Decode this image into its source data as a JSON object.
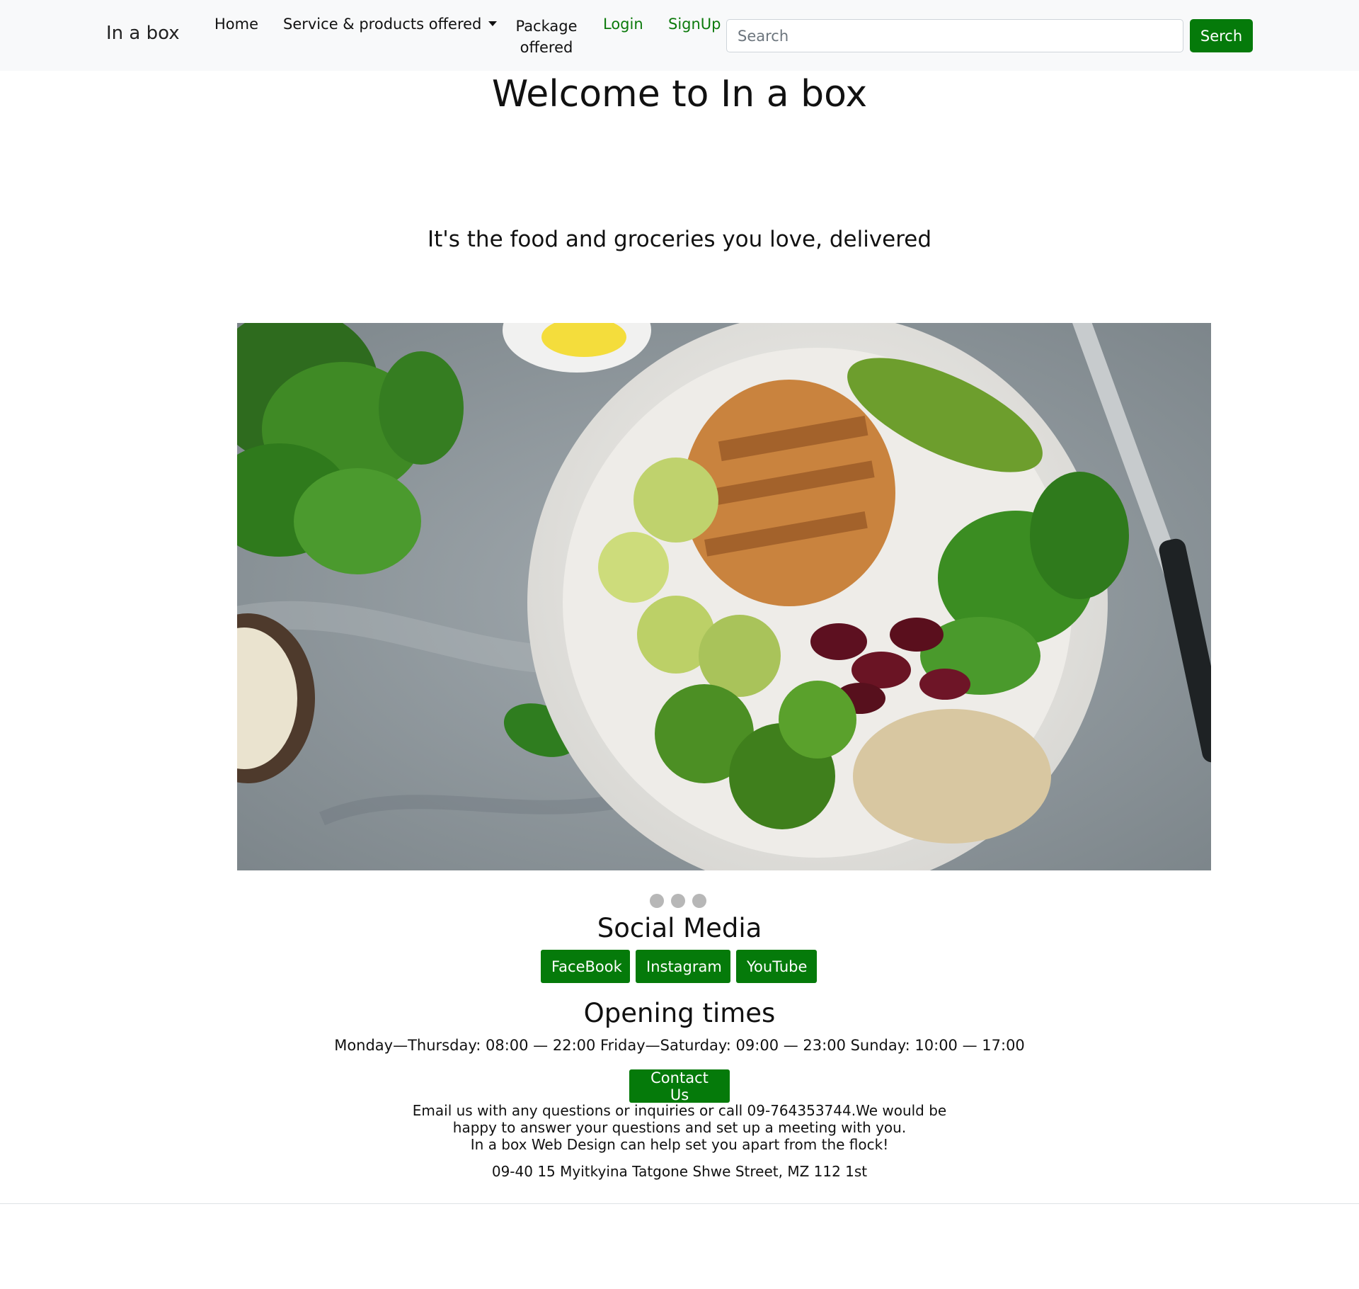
{
  "navbar": {
    "brand": "In a box",
    "home": "Home",
    "service": "Service & products offered",
    "package": "Package offered",
    "login": "Login",
    "signup": "SignUp",
    "search_placeholder": "Search",
    "search_button": "Serch"
  },
  "hero": {
    "title": "Welcome to In a box",
    "tagline": "It's the food and groceries you love, delivered",
    "carousel_slides": 3
  },
  "social": {
    "title": "Social Media",
    "facebook": "FaceBook",
    "instagram": "Instagram",
    "youtube": "YouTube"
  },
  "hours": {
    "title": "Opening times",
    "text": "Monday—Thursday: 08:00 — 22:00 Friday—Saturday: 09:00 — 23:00 Sunday: 10:00 — 17:00"
  },
  "contact": {
    "button": "Contact Us",
    "line1": "Email us with any questions or inquiries or call 09-764353744.We would be happy to answer your questions and set up a meeting with you.",
    "line2": "In a box Web Design can help set you apart from the flock!",
    "address": "09-40 15 Myitkyina Tatgone Shwe Street, MZ 112 1st"
  },
  "colors": {
    "accent": "#057a0a",
    "nav_bg": "#f8f9fa",
    "link_green": "#0c7a0c"
  }
}
